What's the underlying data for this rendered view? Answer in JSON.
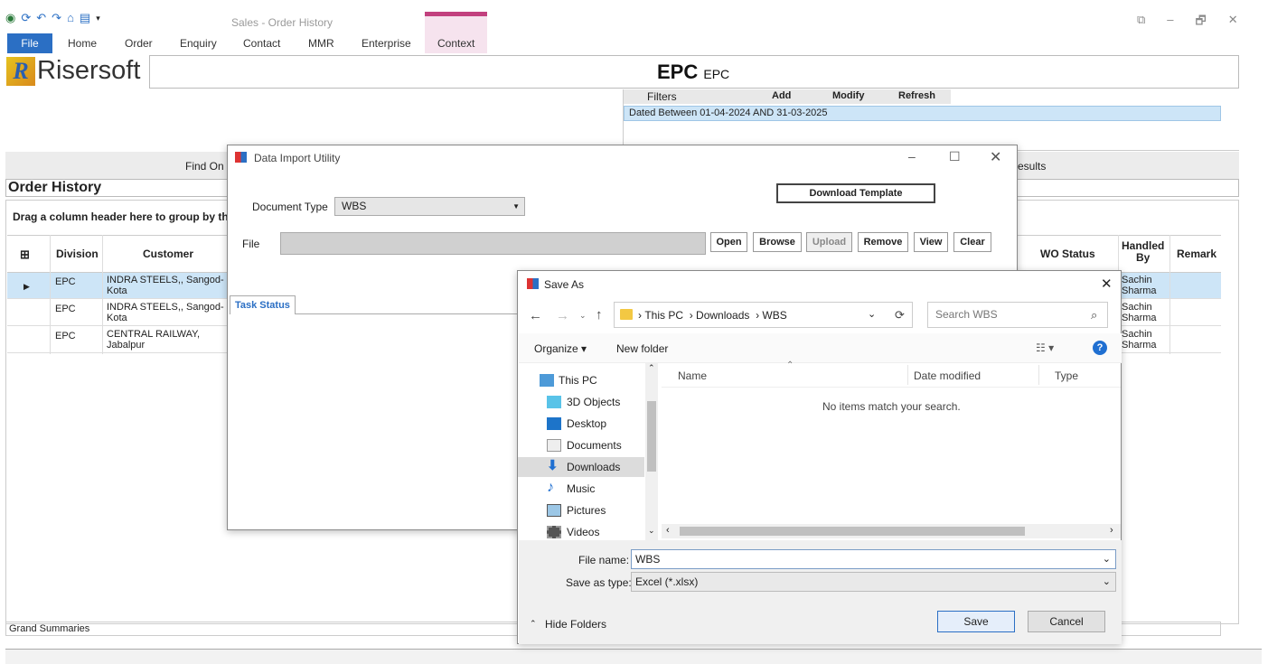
{
  "app": {
    "title": "Sales - Order History",
    "logo_text": "Risersoft",
    "logo_letter": "R"
  },
  "qat_icons": [
    "globe-icon",
    "refresh-icon",
    "undo-icon",
    "redo-icon",
    "home-icon",
    "print-icon",
    "dropdown-icon"
  ],
  "window_controls": [
    "⧉",
    "–",
    "🗗",
    "✕"
  ],
  "menu": {
    "file": "File",
    "items": [
      "Home",
      "Order",
      "Enquiry",
      "Contact",
      "MMR",
      "Enterprise",
      "Context"
    ]
  },
  "header": {
    "main": "EPC",
    "sub": "EPC"
  },
  "filters": {
    "label": "Filters",
    "add": "Add",
    "modify": "Modify",
    "refresh": "Refresh",
    "line": "Dated Between  01-04-2024 AND 31-03-2025"
  },
  "find": {
    "left": "Find On",
    "right": "esults"
  },
  "order_history": {
    "title": "Order History",
    "drag_text": "Drag a column header here to group by th"
  },
  "grid": {
    "headers": {
      "division": "Division",
      "customer": "Customer",
      "wo_status": "WO Status",
      "handled_by": "Handled\nBy",
      "remark": "Remark"
    },
    "rows": [
      {
        "division": "EPC",
        "customer": "INDRA STEELS,, Sangod-\nKota",
        "handled_by": "Sachin\nSharma"
      },
      {
        "division": "EPC",
        "customer": "INDRA STEELS,, Sangod-\nKota",
        "handled_by": "Sachin\nSharma"
      },
      {
        "division": "EPC",
        "customer": "CENTRAL RAILWAY,\nJabalpur",
        "handled_by": "Sachin\nSharma"
      }
    ],
    "grand": "Grand Summaries"
  },
  "import_dialog": {
    "title": "Data Import Utility",
    "download_template": "Download Template",
    "doc_type_label": "Document Type",
    "doc_type_value": "WBS",
    "file_label": "File",
    "buttons": {
      "open": "Open",
      "browse": "Browse",
      "upload": "Upload",
      "remove": "Remove",
      "view": "View",
      "clear": "Clear"
    },
    "task_tab": "Task Status"
  },
  "save_dialog": {
    "title": "Save As",
    "breadcrumb": [
      "This PC",
      "Downloads",
      "WBS"
    ],
    "search_placeholder": "Search WBS",
    "organize": "Organize ▾",
    "new_folder": "New folder",
    "sidebar": [
      "This PC",
      "3D Objects",
      "Desktop",
      "Documents",
      "Downloads",
      "Music",
      "Pictures",
      "Videos"
    ],
    "columns": {
      "name": "Name",
      "date": "Date modified",
      "type": "Type"
    },
    "empty": "No items match your search.",
    "file_name_label": "File name:",
    "file_name": "WBS",
    "save_type_label": "Save as type:",
    "save_type": "Excel (*.xlsx)",
    "hide_folders": "Hide Folders",
    "save": "Save",
    "cancel": "Cancel"
  }
}
